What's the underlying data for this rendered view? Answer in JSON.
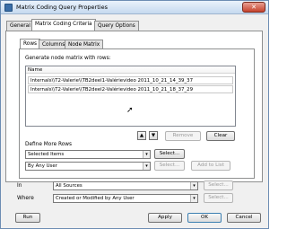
{
  "window": {
    "title": "Matrix Coding Query Properties",
    "close_symbol": "✕"
  },
  "tabs": [
    {
      "label": "General"
    },
    {
      "label": "Matrix Coding Criteria"
    },
    {
      "label": "Query Options"
    }
  ],
  "subtabs": [
    {
      "label": "Rows"
    },
    {
      "label": "Columns"
    },
    {
      "label": "Node Matrix"
    }
  ],
  "rows_panel": {
    "heading": "Generate node matrix with rows:",
    "list_header": "Name",
    "items": [
      "Internals\\\\T2-Valerie\\\\TB2deel1-Valérievideo 2011_10_21_14_39_37",
      "Internals\\\\T2-Valerie\\\\TB2deel2-Valérievideo 2011_10_21_18_37_29"
    ],
    "up_arrow": "▲",
    "down_arrow": "▼",
    "remove_label": "Remove",
    "clear_label": "Clear"
  },
  "define_more_rows": {
    "label": "Define More Rows",
    "combo1": "Selected Items",
    "combo2": "By Any User",
    "select1_label": "Select...",
    "select2_label": "Select...",
    "add_to_list_label": "Add to List"
  },
  "in_row": {
    "label": "In",
    "value": "All Sources",
    "select_label": "Select..."
  },
  "where_row": {
    "label": "Where",
    "value": "Created or Modified by Any User",
    "select_label": "Select..."
  },
  "footer": {
    "run_label": "Run",
    "apply_label": "Apply",
    "ok_label": "OK",
    "cancel_label": "Cancel"
  },
  "combo_arrow": "▾"
}
